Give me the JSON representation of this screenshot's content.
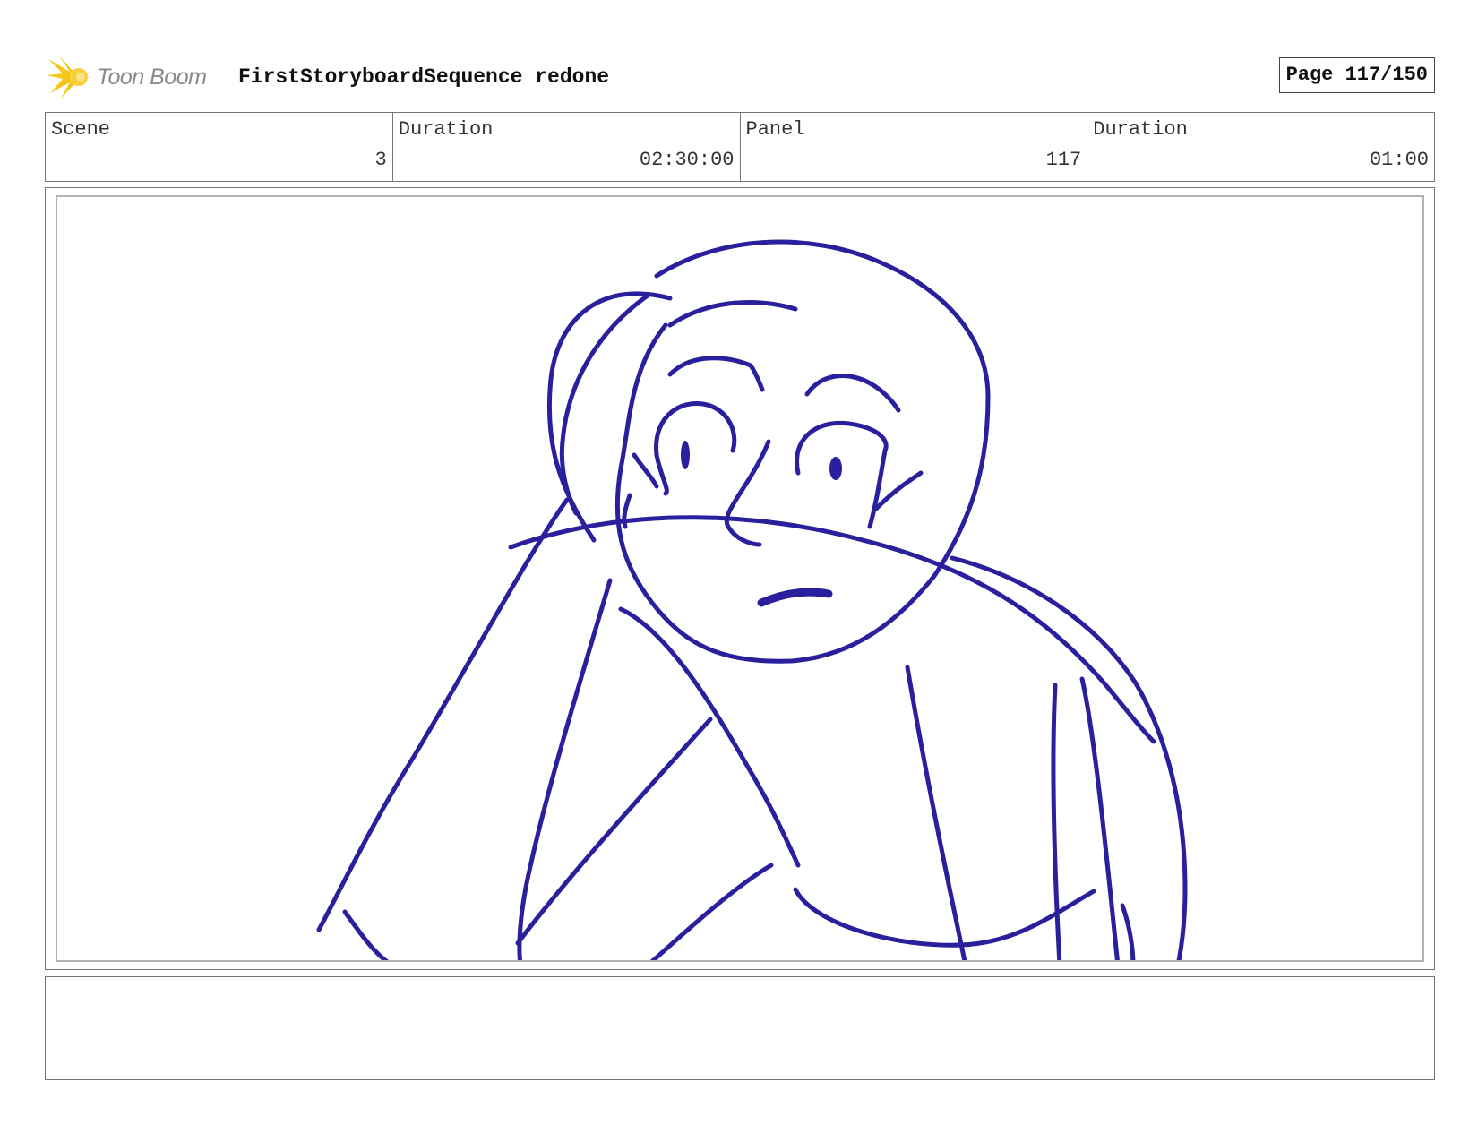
{
  "header": {
    "logo_text": "Toon Boom",
    "logo_icon": "toon-boom-burst-icon",
    "title": "FirstStoryboardSequence redone",
    "page_label": "Page 117/150"
  },
  "info": {
    "scene_label": "Scene",
    "scene_value": "3",
    "scene_duration_label": "Duration",
    "scene_duration_value": "02:30:00",
    "panel_label": "Panel",
    "panel_value": "117",
    "panel_duration_label": "Duration",
    "panel_duration_value": "01:00"
  },
  "panel": {
    "drawing": "sketch-character-leaning-forward",
    "stroke_color": "#2a1f9c",
    "frame_color": "#b3b3b3"
  },
  "notes": {
    "text": ""
  },
  "colors": {
    "logo_burst": "#f5c518",
    "logo_text": "#8a8a8a",
    "border": "#777777"
  }
}
